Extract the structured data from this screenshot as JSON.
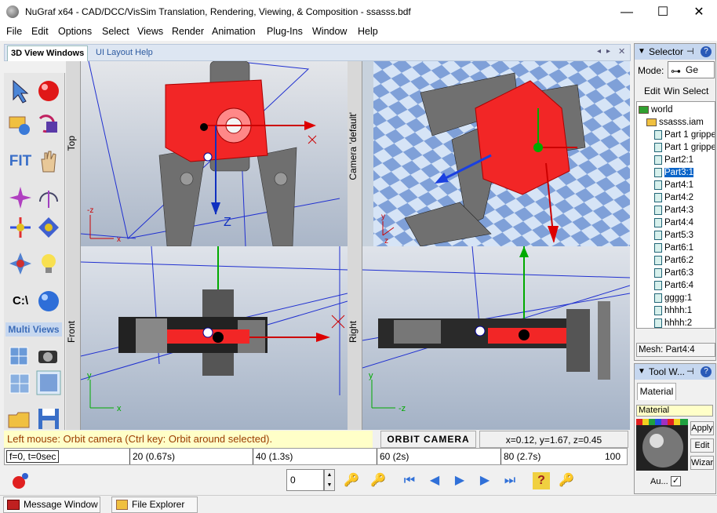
{
  "window": {
    "title": "NuGraf x64 - CAD/DCC/VisSim Translation, Rendering, Viewing, & Composition - ssasss.bdf",
    "minimize": "—",
    "maximize": "☐",
    "close": "✕"
  },
  "menu": [
    "File",
    "Edit",
    "Options",
    "Select",
    "Views",
    "Render",
    "Animation",
    "Plug-Ins",
    "Window",
    "Help"
  ],
  "tabs": {
    "active": "3D View Windows",
    "inactive": "UI Layout Help"
  },
  "toolbox": {
    "fit": "FIT",
    "section": "Multi Views",
    "drive": "C:\\"
  },
  "views": {
    "top": "Top",
    "camera": "Camera 'default'",
    "front": "Front",
    "right": "Right",
    "axes": {
      "top_z": "-z",
      "top_x": "x",
      "front_y": "y",
      "front_x": "x",
      "right_y": "y",
      "right_z": "-z",
      "cam_y": "y",
      "cam_z": "z",
      "z_label": "Z"
    }
  },
  "status": {
    "message": "Left mouse: Orbit camera (Ctrl key: Orbit around selected).",
    "mode": "ORBIT CAMERA",
    "coords": "x=0.12, y=1.67, z=0.45"
  },
  "timeline": {
    "current": "f=0, t=0sec",
    "marks": [
      "20 (0.67s)",
      "40 (1.3s)",
      "60 (2s)",
      "80 (2.7s)",
      "100"
    ],
    "markfractions": [
      0.2,
      0.4,
      0.6,
      0.8,
      1.0
    ]
  },
  "player": {
    "frame": "0"
  },
  "bottom_tabs": [
    "Message Window",
    "File Explorer"
  ],
  "selector": {
    "title": "Selector",
    "mode_label": "Mode:",
    "mode_value": "Ge",
    "actions": [
      "Edit",
      "Win",
      "Select"
    ],
    "tree": [
      {
        "label": "world",
        "level": 0,
        "type": "folder"
      },
      {
        "label": "ssasss.iam",
        "level": 1,
        "type": "folder"
      },
      {
        "label": "Part 1 grippe",
        "level": 2,
        "type": "part"
      },
      {
        "label": "Part 1 grippe",
        "level": 2,
        "type": "part"
      },
      {
        "label": "Part2:1",
        "level": 2,
        "type": "part"
      },
      {
        "label": "Part3:1",
        "level": 2,
        "type": "part",
        "selected": true
      },
      {
        "label": "Part4:1",
        "level": 2,
        "type": "part"
      },
      {
        "label": "Part4:2",
        "level": 2,
        "type": "part"
      },
      {
        "label": "Part4:3",
        "level": 2,
        "type": "part"
      },
      {
        "label": "Part4:4",
        "level": 2,
        "type": "part"
      },
      {
        "label": "Part5:3",
        "level": 2,
        "type": "part"
      },
      {
        "label": "Part6:1",
        "level": 2,
        "type": "part"
      },
      {
        "label": "Part6:2",
        "level": 2,
        "type": "part"
      },
      {
        "label": "Part6:3",
        "level": 2,
        "type": "part"
      },
      {
        "label": "Part6:4",
        "level": 2,
        "type": "part"
      },
      {
        "label": "gggg:1",
        "level": 2,
        "type": "part"
      },
      {
        "label": "hhhh:1",
        "level": 2,
        "type": "part"
      },
      {
        "label": "hhhh:2",
        "level": 2,
        "type": "part"
      }
    ],
    "mesh": "Mesh: Part4:4"
  },
  "toolwin": {
    "title": "Tool W...",
    "tab": "Material",
    "field": "Material",
    "apply": "Apply",
    "edit": "Edit",
    "wizard": "Wizard",
    "auto": "Au..."
  }
}
